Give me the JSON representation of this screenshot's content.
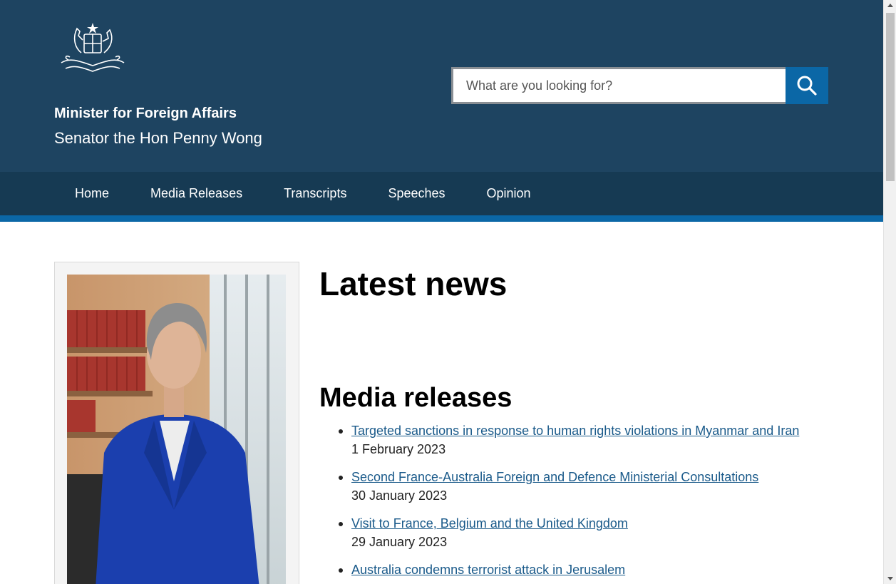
{
  "header": {
    "crest_icon": "commonwealth-coat-of-arms",
    "title": "Minister for Foreign Affairs",
    "subtitle": "Senator the Hon Penny Wong",
    "background": "#1e4461"
  },
  "search": {
    "placeholder": "What are you looking for?",
    "button_icon": "search-icon",
    "button_color": "#0b67a6"
  },
  "nav": {
    "items": [
      {
        "label": "Home"
      },
      {
        "label": "Media Releases"
      },
      {
        "label": "Transcripts"
      },
      {
        "label": "Speeches"
      },
      {
        "label": "Opinion"
      }
    ]
  },
  "main": {
    "latest_heading": "Latest news",
    "media_heading": "Media releases",
    "releases": [
      {
        "title": "Targeted sanctions in response to human rights violations in Myanmar and Iran",
        "date": "1 February 2023"
      },
      {
        "title": "Second France-Australia Foreign and Defence Ministerial Consultations",
        "date": "30 January 2023"
      },
      {
        "title": "Visit to France, Belgium and the United Kingdom",
        "date": "29 January 2023"
      },
      {
        "title": "Australia condemns terrorist attack in Jerusalem",
        "date": ""
      }
    ]
  }
}
